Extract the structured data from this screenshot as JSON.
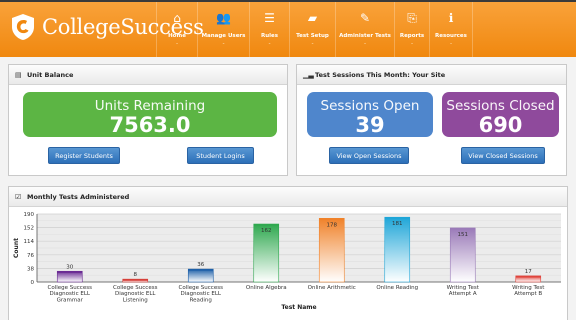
{
  "brand": {
    "name": "CollegeSuccess",
    "accent": "#f39a26"
  },
  "nav": [
    {
      "icon": "home-icon",
      "glyph": "⌂",
      "label": "Home"
    },
    {
      "icon": "users-icon",
      "glyph": "👥",
      "label": "Manage Users"
    },
    {
      "icon": "rules-icon",
      "glyph": "☰",
      "label": "Rules"
    },
    {
      "icon": "test-setup-icon",
      "glyph": "▰",
      "label": "Test Setup"
    },
    {
      "icon": "administer-icon",
      "glyph": "✎",
      "label": "Administer Tests"
    },
    {
      "icon": "reports-icon",
      "glyph": "⎘",
      "label": "Reports"
    },
    {
      "icon": "resources-icon",
      "glyph": "ℹ",
      "label": "Resources"
    }
  ],
  "unit_balance": {
    "title": "Unit Balance",
    "units_label": "Units Remaining",
    "units_value": "7563.0",
    "register_button": "Register Students",
    "logins_button": "Student Logins"
  },
  "sessions": {
    "title": "Test Sessions This Month: Your Site",
    "open_label": "Sessions Open",
    "open_value": "39",
    "closed_label": "Sessions Closed",
    "closed_value": "690",
    "view_open_button": "View Open Sessions",
    "view_closed_button": "View Closed Sessions"
  },
  "monthly": {
    "title": "Monthly Tests Administered"
  },
  "chart_data": {
    "type": "bar",
    "ylabel": "Count",
    "xlabel": "Test Name",
    "ylim": [
      0,
      190
    ],
    "yticks": [
      0,
      38,
      76,
      114,
      152,
      190
    ],
    "categories": [
      "College Success Diagnostic ELL Grammar",
      "College Success Diagnostic ELL Listening",
      "College Success Diagnostic ELL Reading",
      "Online Algebra",
      "Online Arithmetic",
      "Online Reading",
      "Writing Test Attempt A",
      "Writing Test Attempt B"
    ],
    "category_lines": [
      [
        "College Success",
        "Diagnostic ELL",
        "Grammar"
      ],
      [
        "College Success",
        "Diagnostic ELL",
        "Listening"
      ],
      [
        "College Success",
        "Diagnostic ELL",
        "Reading"
      ],
      [
        "Online Algebra"
      ],
      [
        "Online Arithmetic"
      ],
      [
        "Online Reading"
      ],
      [
        "Writing Test",
        "Attempt A"
      ],
      [
        "Writing Test",
        "Attempt B"
      ]
    ],
    "values": [
      30,
      8,
      36,
      162,
      178,
      181,
      151,
      17
    ],
    "colors": [
      "#6a2b93",
      "#d6403a",
      "#1d5fa8",
      "#2fa84f",
      "#f0822a",
      "#1fa6d8",
      "#9a7ab8",
      "#e0443c"
    ]
  }
}
